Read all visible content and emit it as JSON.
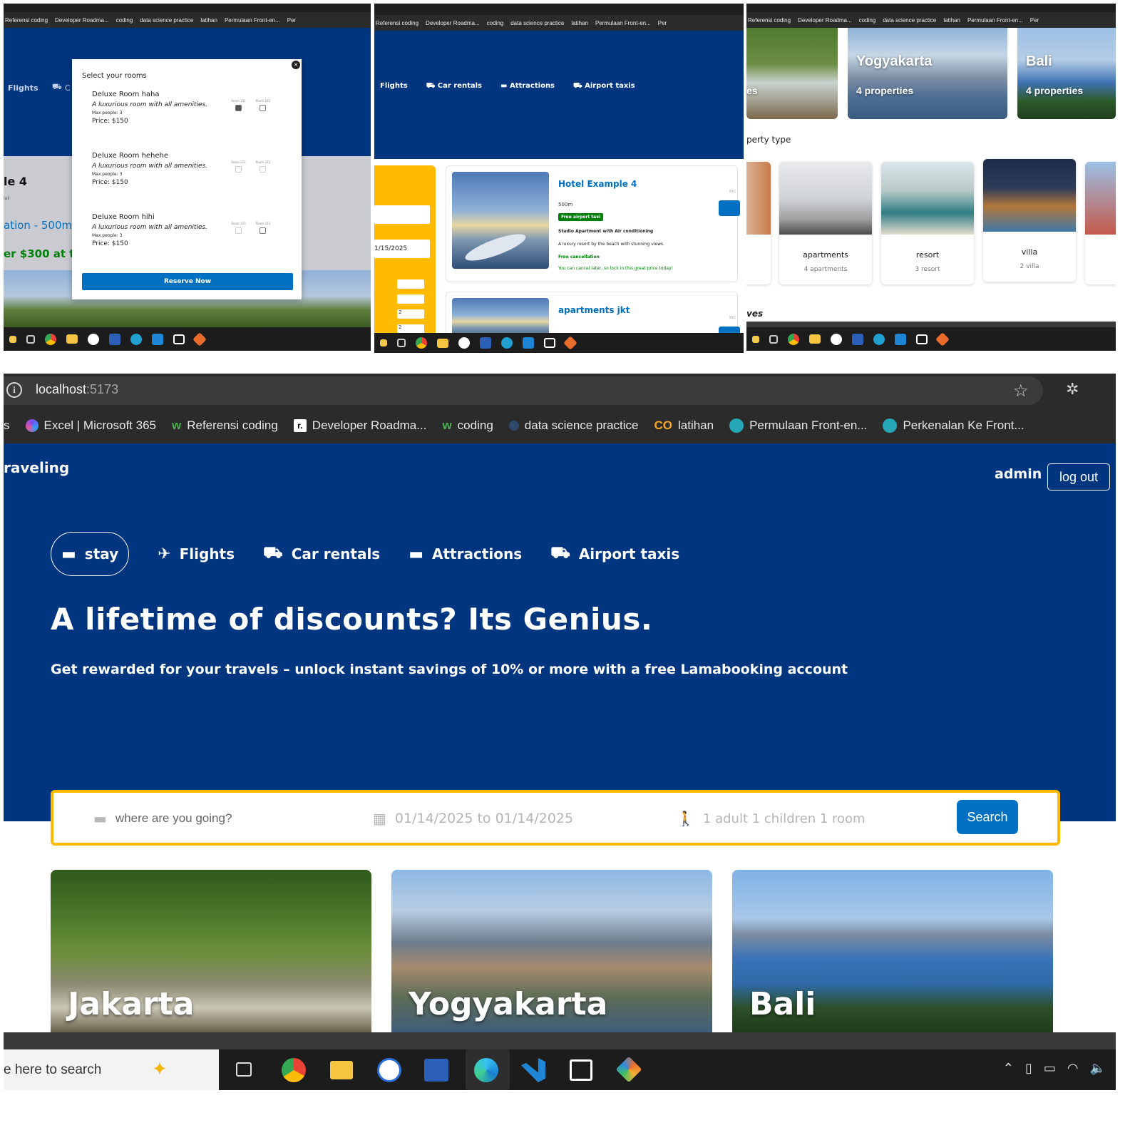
{
  "bookmarks_small": [
    "Referensi coding",
    "Developer Roadma...",
    "coding",
    "data science practice",
    "latihan",
    "Permulaan Front-en...",
    "Per"
  ],
  "panel1": {
    "nav_flights": "Flights",
    "nav_car": "C",
    "side_title": "le 4",
    "side_sub": "lali",
    "side_loc": "ation - 500m",
    "side_price": "er $300 at tl",
    "modal": {
      "title": "Select your rooms",
      "close": "×",
      "rooms": [
        {
          "name": "Deluxe Room haha",
          "desc": "A luxurious room with all amenities.",
          "max": "Max people: 3",
          "price": "Price: $150",
          "room_a": "Room 101",
          "room_b": "Room 102",
          "checked": true
        },
        {
          "name": "Deluxe Room hehehe",
          "desc": "A luxurious room with all amenities.",
          "max": "Max people: 3",
          "price": "Price: $150",
          "room_a": "Room 222",
          "room_b": "Room 222",
          "checked": false
        },
        {
          "name": "Deluxe Room hihi",
          "desc": "A luxurious room with all amenities.",
          "max": "Max people: 3",
          "price": "Price: $150",
          "room_a": "Room 223",
          "room_b": "Room 223",
          "checked": false
        }
      ],
      "reserve": "Reserve Now"
    }
  },
  "panel2": {
    "nav": [
      "Flights",
      "Car rentals",
      "Attractions",
      "Airport taxis"
    ],
    "date": "1/15/2025",
    "guest_a": "2",
    "guest_b": "2",
    "hotel1": {
      "name": "Hotel Example 4",
      "distance": "500m",
      "taxi": "Free airport taxi",
      "feature": "Studio Apartment with Air conditioning",
      "desc": "A luxury resort by the beach with stunning views.",
      "cancel": "Free cancellation",
      "lock": "You can cancel later, so lock in this great price today!",
      "incl": "Inc"
    },
    "hotel2": {
      "name": "apartments jkt",
      "incl": "Inc"
    }
  },
  "panel3": {
    "dest": [
      {
        "name": "",
        "count": "es"
      },
      {
        "name": "Yogyakarta",
        "count": "4 properties"
      },
      {
        "name": "Bali",
        "count": "4 properties"
      }
    ],
    "ptype_title": "perty type",
    "ptypes": [
      {
        "name": "apartments",
        "count": "4 apartments"
      },
      {
        "name": "resort",
        "count": "3 resort"
      },
      {
        "name": "villa",
        "count": "2 villa"
      }
    ],
    "ves": "ves"
  },
  "main": {
    "url_host": "localhost",
    "url_port": ":5173",
    "bookmarks": [
      "s",
      "Excel | Microsoft 365",
      "Referensi coding",
      "Developer Roadma...",
      "coding",
      "data science practice",
      "latihan",
      "Permulaan Front-en...",
      "Perkenalan Ke Front..."
    ],
    "logo": "raveling",
    "user": "admin",
    "logout": "log out",
    "tabs": [
      "stay",
      "Flights",
      "Car rentals",
      "Attractions",
      "Airport taxis"
    ],
    "headline": "A lifetime of discounts? Its Genius.",
    "subline": "Get rewarded for your travels – unlock instant savings of 10% or more with a free Lamabooking account",
    "search": {
      "destination_placeholder": "where are you going?",
      "dates": "01/14/2025 to 01/14/2025",
      "guests": "1 adult 1 children 1 room",
      "button": "Search"
    },
    "destinations": [
      "Jakarta",
      "Yogyakarta",
      "Bali"
    ],
    "taskbar_search": "e here to search"
  },
  "colors": {
    "brand_blue": "#003580",
    "accent_blue": "#0071c2",
    "accent_yellow": "#febb02",
    "green": "#008009"
  }
}
